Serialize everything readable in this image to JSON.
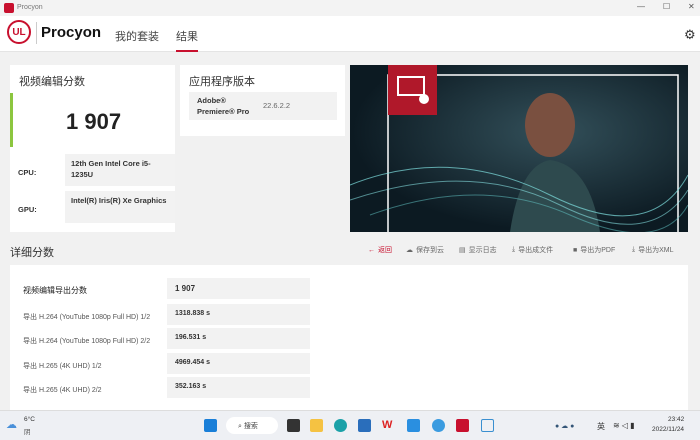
{
  "window": {
    "title": "Procyon"
  },
  "header": {
    "logo": "UL",
    "brand": "Procyon",
    "tabs": [
      {
        "label": "我的套装"
      },
      {
        "label": "结果",
        "active": true
      }
    ]
  },
  "score_card": {
    "title": "视频编辑分数",
    "score": "1 907",
    "cpu_label": "CPU:",
    "cpu": "12th Gen Intel Core i5-1235U",
    "gpu_label": "GPU:",
    "gpu": "Intel(R) Iris(R) Xe Graphics",
    "accent": "#8cc63f"
  },
  "app_card": {
    "title": "应用程序版本",
    "app": "Adobe® Premiere® Pro",
    "version": "22.6.2.2"
  },
  "details": {
    "title": "详细分数",
    "toolbar": [
      {
        "label": "返回",
        "icon": "arrow-left-icon"
      },
      {
        "label": "保存到云",
        "icon": "cloud-upload-icon"
      },
      {
        "label": "显示日志",
        "icon": "document-icon"
      },
      {
        "label": "导出成文件",
        "icon": "download-icon"
      },
      {
        "label": "导出为PDF",
        "icon": "save-icon"
      },
      {
        "label": "导出为XML",
        "icon": "download-icon"
      }
    ],
    "rows": [
      {
        "label": "视频编辑导出分数",
        "value": "1 907"
      },
      {
        "label": "导出 H.264 (YouTube 1080p Full HD) 1/2",
        "value": "1318.838 s"
      },
      {
        "label": "导出 H.264 (YouTube 1080p Full HD) 2/2",
        "value": "196.531 s"
      },
      {
        "label": "导出 H.265 (4K UHD) 1/2",
        "value": "4969.454 s"
      },
      {
        "label": "导出 H.265 (4K UHD) 2/2",
        "value": "352.163 s"
      }
    ]
  },
  "taskbar": {
    "weather_temp": "6°C",
    "weather_desc": "阴",
    "search": "搜索",
    "ime": "英",
    "time": "23:42",
    "date": "2022/11/24"
  },
  "colors": {
    "brand": "#c8102e"
  }
}
